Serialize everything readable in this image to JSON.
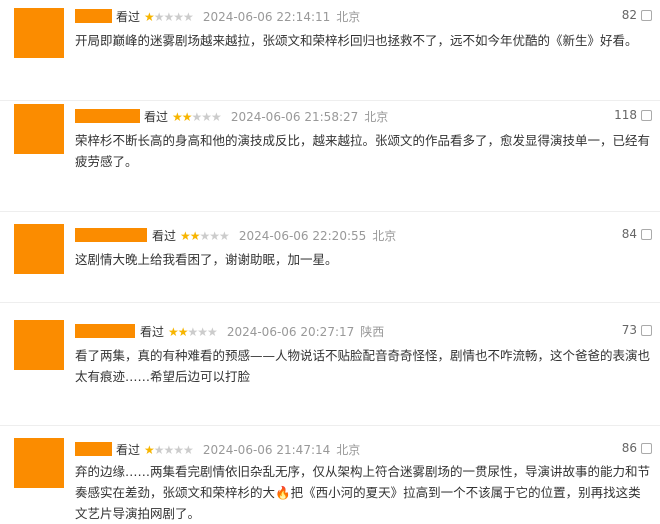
{
  "reviews": [
    {
      "status": "看过",
      "rating": 1,
      "time": "2024-06-06 22:14:11",
      "location": "北京",
      "votes": "82",
      "text": "开局即巅峰的迷雾剧场越来越拉，张颂文和荣梓杉回归也拯救不了，远不如今年优酷的《新生》好看。"
    },
    {
      "status": "看过",
      "rating": 2,
      "time": "2024-06-06 21:58:27",
      "location": "北京",
      "votes": "118",
      "text": "荣梓杉不断长高的身高和他的演技成反比，越来越拉。张颂文的作品看多了，愈发显得演技单一，已经有疲劳感了。"
    },
    {
      "status": "看过",
      "rating": 2,
      "time": "2024-06-06 22:20:55",
      "location": "北京",
      "votes": "84",
      "text": "这剧情大晚上给我看困了，谢谢助眠，加一星。"
    },
    {
      "status": "看过",
      "rating": 2,
      "time": "2024-06-06 20:27:17",
      "location": "陕西",
      "votes": "73",
      "text": "看了两集，真的有种难看的预感——人物说话不贴脸配音奇奇怪怪，剧情也不咋流畅，这个爸爸的表演也太有痕迹……希望后边可以打脸"
    },
    {
      "status": "看过",
      "rating": 1,
      "time": "2024-06-06 21:47:14",
      "location": "北京",
      "votes": "86",
      "text": "弃的边缘……两集看完剧情依旧杂乱无序，仅从架构上符合迷雾剧场的一贯尿性，导演讲故事的能力和节奏感实在差劲，张颂文和荣梓杉的大🔥把《西小河的夏天》拉高到一个不该属于它的位置，别再找这类文艺片导演拍网剧了。"
    }
  ]
}
